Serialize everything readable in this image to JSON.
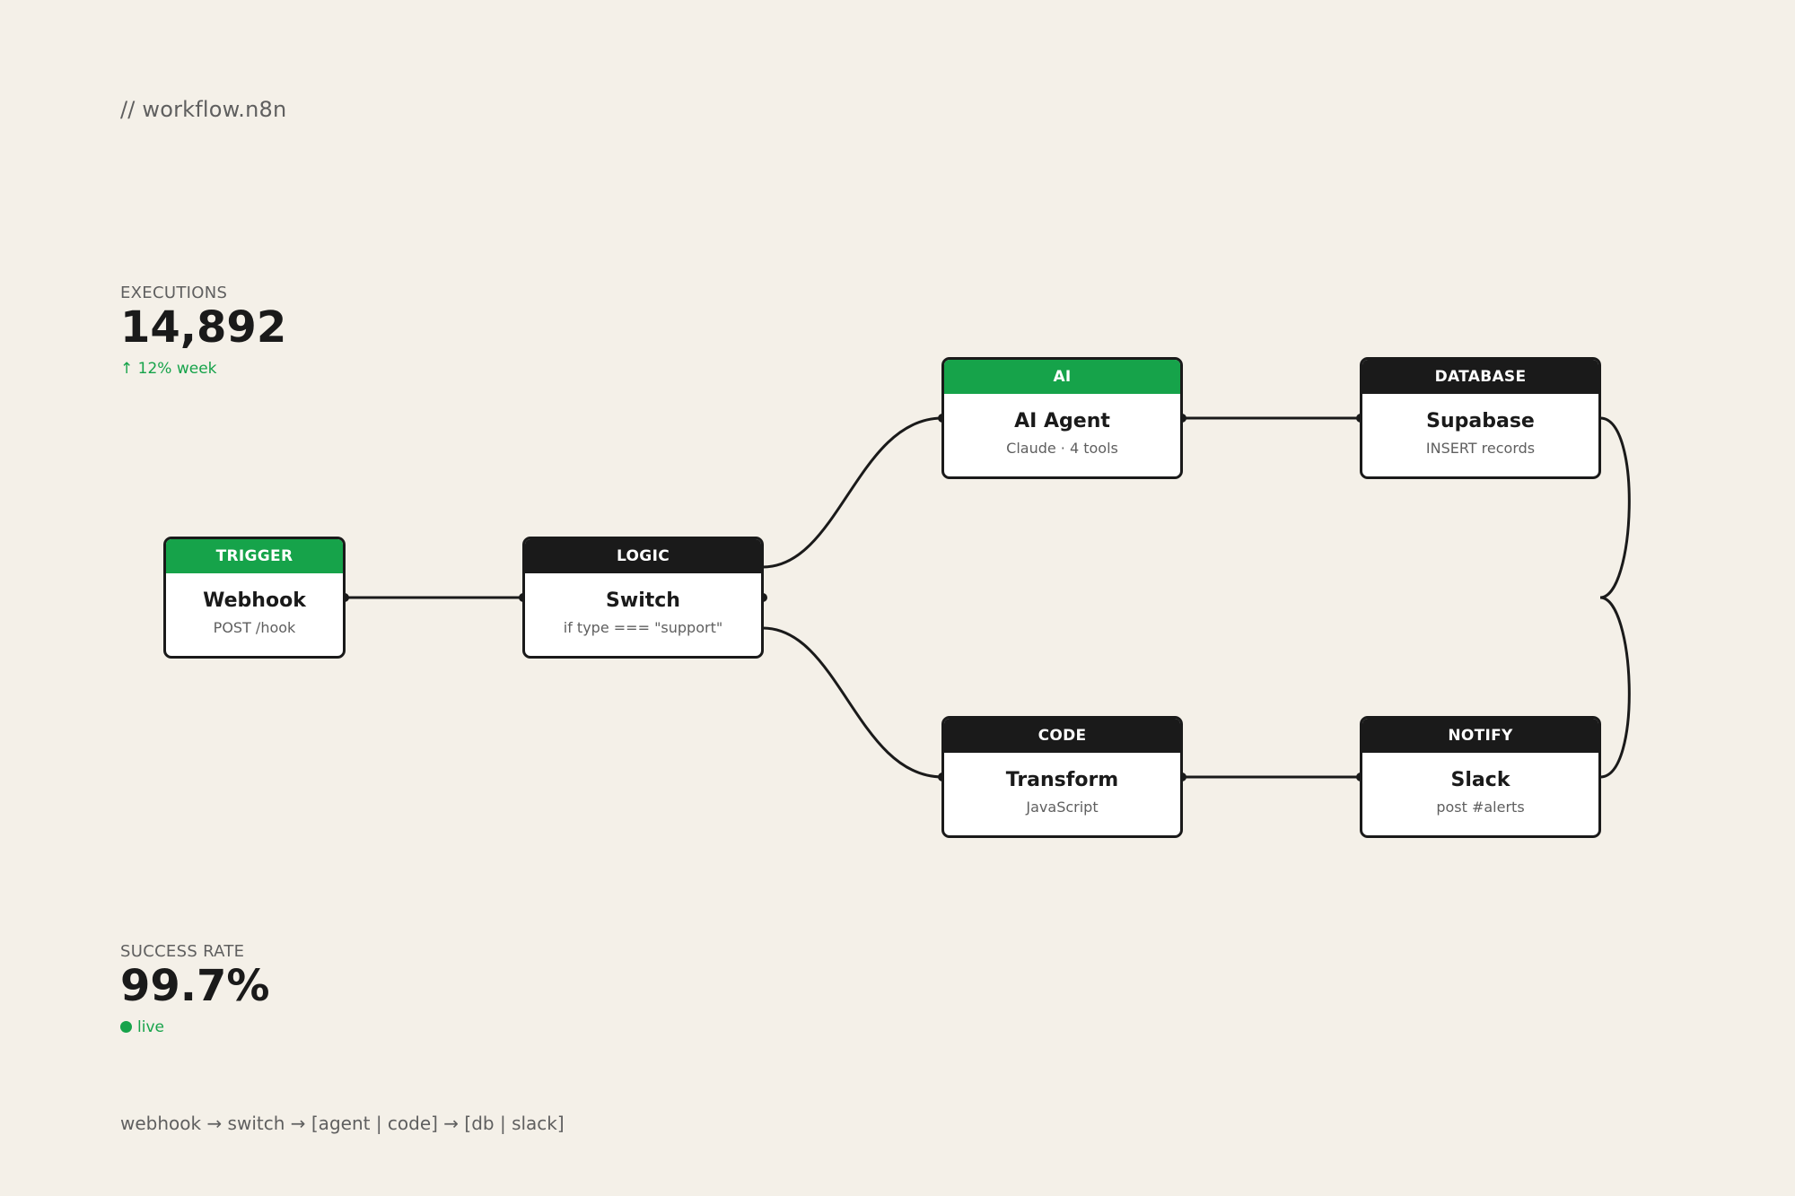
{
  "header": {
    "title": "// workflow.n8n"
  },
  "stats": {
    "executions": {
      "label": "EXECUTIONS",
      "value": "14,892",
      "note": "↑ 12% week"
    },
    "success": {
      "label": "SUCCESS RATE",
      "value": "99.7%",
      "note": "live"
    }
  },
  "nodes": {
    "webhook": {
      "category": "TRIGGER",
      "title": "Webhook",
      "subtitle": "POST /hook"
    },
    "switch": {
      "category": "LOGIC",
      "title": "Switch",
      "subtitle": "if type === \"support\""
    },
    "agent": {
      "category": "AI",
      "title": "AI Agent",
      "subtitle": "Claude · 4 tools"
    },
    "supabase": {
      "category": "DATABASE",
      "title": "Supabase",
      "subtitle": "INSERT records"
    },
    "transform": {
      "category": "CODE",
      "title": "Transform",
      "subtitle": "JavaScript"
    },
    "slack": {
      "category": "NOTIFY",
      "title": "Slack",
      "subtitle": "post #alerts"
    }
  },
  "footer": {
    "text": "webhook → switch → [agent | code] → [db | slack]"
  },
  "colors": {
    "accent": "#16a34a",
    "dark": "#1a1a1a",
    "background": "#f4f0e8"
  }
}
